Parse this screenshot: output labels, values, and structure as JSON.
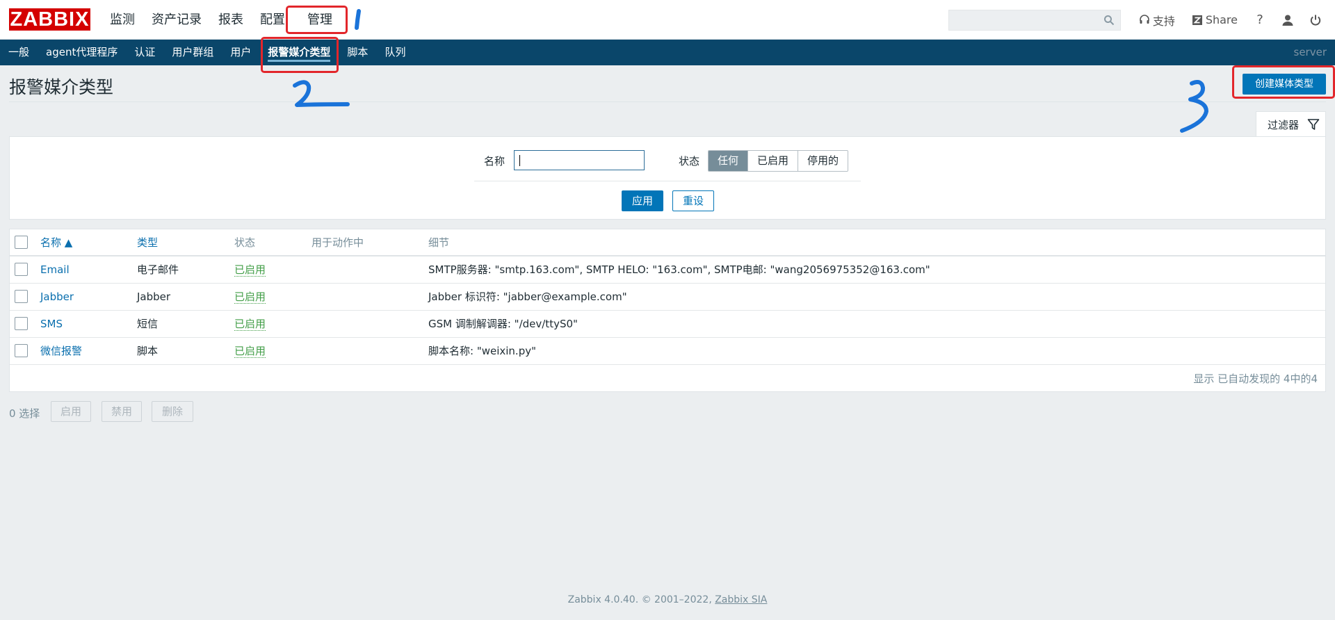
{
  "topbar": {
    "logo": "ZABBIX",
    "nav": [
      "监测",
      "资产记录",
      "报表",
      "配置",
      "管理"
    ],
    "support": "支持",
    "share": "Share",
    "help": "?"
  },
  "subnav": {
    "items": [
      "一般",
      "agent代理程序",
      "认证",
      "用户群组",
      "用户",
      "报警媒介类型",
      "脚本",
      "队列"
    ],
    "server": "server"
  },
  "header": {
    "title": "报警媒介类型",
    "create_button": "创建媒体类型",
    "filter_tab": "过滤器"
  },
  "filter": {
    "name_label": "名称",
    "name_value": "",
    "status_label": "状态",
    "status_options": [
      "任何",
      "已启用",
      "停用的"
    ],
    "status_selected": "任何",
    "apply": "应用",
    "reset": "重设"
  },
  "table": {
    "columns": [
      "名称 ▲",
      "类型",
      "状态",
      "用于动作中",
      "细节"
    ],
    "rows": [
      {
        "name": "Email",
        "type": "电子邮件",
        "status": "已启用",
        "used": "",
        "details": "SMTP服务器: \"smtp.163.com\", SMTP HELO: \"163.com\", SMTP电邮: \"wang2056975352@163.com\""
      },
      {
        "name": "Jabber",
        "type": "Jabber",
        "status": "已启用",
        "used": "",
        "details": "Jabber 标识符: \"jabber@example.com\""
      },
      {
        "name": "SMS",
        "type": "短信",
        "status": "已启用",
        "used": "",
        "details": "GSM 调制解调器: \"/dev/ttyS0\""
      },
      {
        "name": "微信报警",
        "type": "脚本",
        "status": "已启用",
        "used": "",
        "details": "脚本名称: \"weixin.py\""
      }
    ],
    "footnote": "显示 已自动发现的 4中的4"
  },
  "actions": {
    "selected": "0 选择",
    "enable": "启用",
    "disable": "禁用",
    "delete": "删除"
  },
  "footer": {
    "text": "Zabbix 4.0.40. © 2001–2022, ",
    "company": "Zabbix SIA"
  },
  "colors": {
    "brand_red": "#d40000",
    "subnav_bg": "#0a466a",
    "primary_button": "#0275b8",
    "link": "#0a6fae",
    "enabled_green": "#429e47",
    "annotation_red": "#e2262b",
    "annotation_blue": "#1a73d9"
  }
}
